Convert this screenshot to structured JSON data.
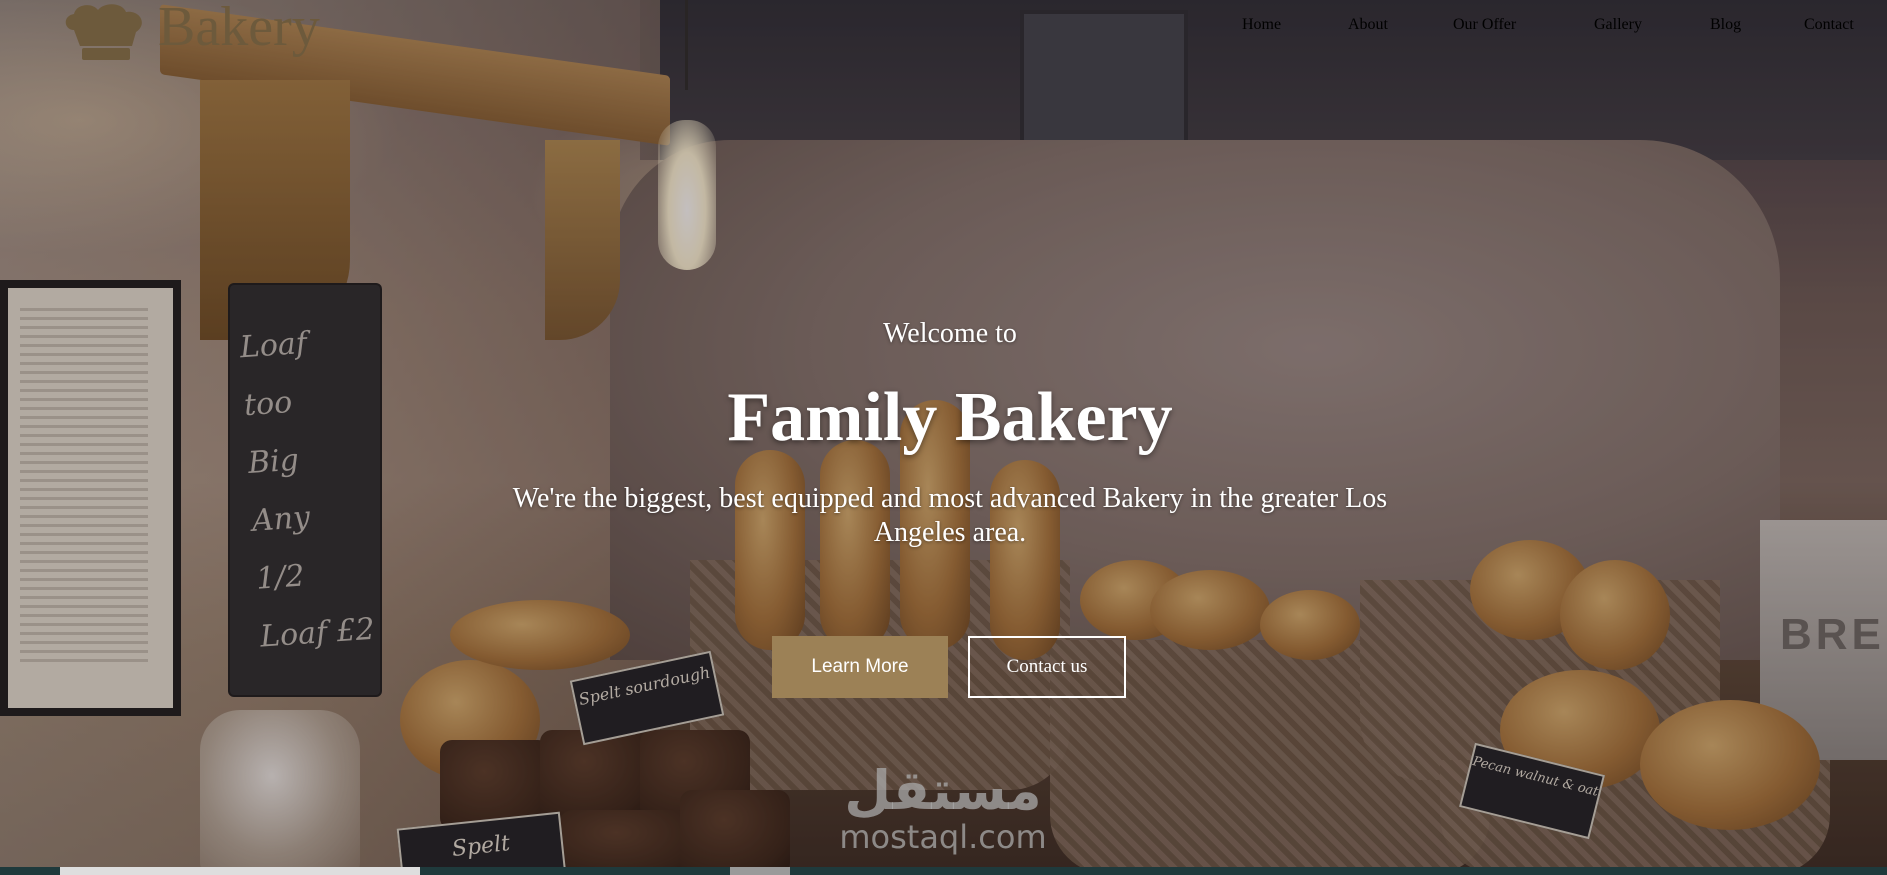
{
  "brand": {
    "name": "Bakery",
    "logo_icon": "chef-hat-icon",
    "logo_color": "#6d5a3c"
  },
  "nav": {
    "items": [
      "Home",
      "About",
      "Our Offer",
      "Gallery",
      "Blog",
      "Contact"
    ]
  },
  "hero": {
    "welcome": "Welcome to",
    "title": "Family Bakery",
    "subtitle": "We're the biggest, best equipped and most advanced Bakery in the greater Los Angeles area.",
    "learn_more_label": "Learn More",
    "contact_label": "Contact us",
    "accent_color": "#9c8156"
  },
  "scene": {
    "chalkboard": [
      "Loaf too",
      "Big",
      "Any 1/2",
      "Loaf £2"
    ],
    "tags": [
      "Spelt sourdough",
      "Spelt",
      "Pecan walnut & oat"
    ],
    "bin_label": "BRE"
  },
  "watermark": {
    "arabic": "مستقل",
    "latin": "mostaql.com"
  }
}
